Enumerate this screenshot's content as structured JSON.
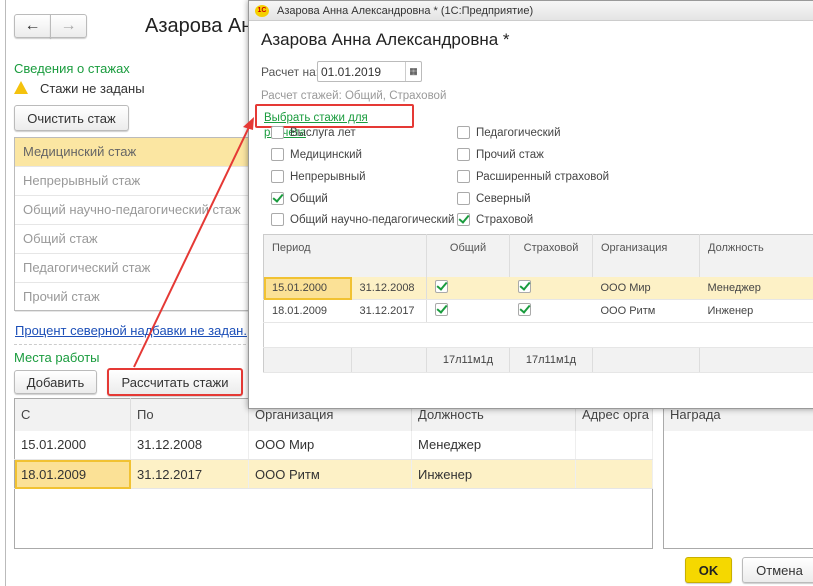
{
  "main": {
    "title": "Азарова Анн",
    "section_title": "Сведения о стажах",
    "warning": "Стажи не заданы",
    "clear_button": "Очистить стаж",
    "stazh_list": [
      "Медицинский стаж",
      "Непрерывный стаж",
      "Общий научно-педагогический стаж",
      "Общий стаж",
      "Педагогический стаж",
      "Прочий стаж"
    ],
    "north_link": "Процент северной надбавки не задан.",
    "work_title": "Места работы",
    "add_button": "Добавить",
    "calc_button": "Рассчитать стажи",
    "table": {
      "headers": [
        "С",
        "По",
        "Организация",
        "Должность",
        "Адрес орга"
      ],
      "rows": [
        [
          "15.01.2000",
          "31.12.2008",
          "ООО Мир",
          "Менеджер",
          ""
        ],
        [
          "18.01.2009",
          "31.12.2017",
          "ООО Ритм",
          "Инженер",
          ""
        ]
      ]
    },
    "award_header": "Награда",
    "ok": "OK",
    "cancel": "Отмена"
  },
  "popup": {
    "window_title": "Азарова Анна Александровна * (1С:Предприятие)",
    "logo": "1С",
    "heading": "Азарова Анна Александровна *",
    "date_label": "Расчет на:",
    "date_value": "01.01.2019",
    "calc_info": "Расчет стажей: Общий, Страховой",
    "select_link": "Выбрать стажи для расчета",
    "checkboxes": [
      {
        "label": "Выслуга лет",
        "checked": false
      },
      {
        "label": "Медицинский",
        "checked": false
      },
      {
        "label": "Непрерывный",
        "checked": false
      },
      {
        "label": "Общий",
        "checked": true
      },
      {
        "label": "Общий научно-педагогический",
        "checked": false
      },
      {
        "label": "Педагогический",
        "checked": false
      },
      {
        "label": "Прочий стаж",
        "checked": false
      },
      {
        "label": "Расширенный страховой",
        "checked": false
      },
      {
        "label": "Северный",
        "checked": false
      },
      {
        "label": "Страховой",
        "checked": true
      }
    ],
    "table": {
      "headers": [
        "Период",
        "",
        "Общий",
        "Страховой",
        "Организация",
        "Должность"
      ],
      "rows": [
        [
          "15.01.2000",
          "31.12.2008",
          true,
          true,
          "ООО Мир",
          "Менеджер"
        ],
        [
          "18.01.2009",
          "31.12.2017",
          true,
          true,
          "ООО Ритм",
          "Инженер"
        ]
      ],
      "totals": [
        "17л11м1д",
        "17л11м1д"
      ]
    }
  },
  "colors": {
    "accent_green": "#1a9c3e",
    "highlight": "#e53935",
    "selection": "#fbe6a2",
    "ok_button": "#f5d800"
  }
}
